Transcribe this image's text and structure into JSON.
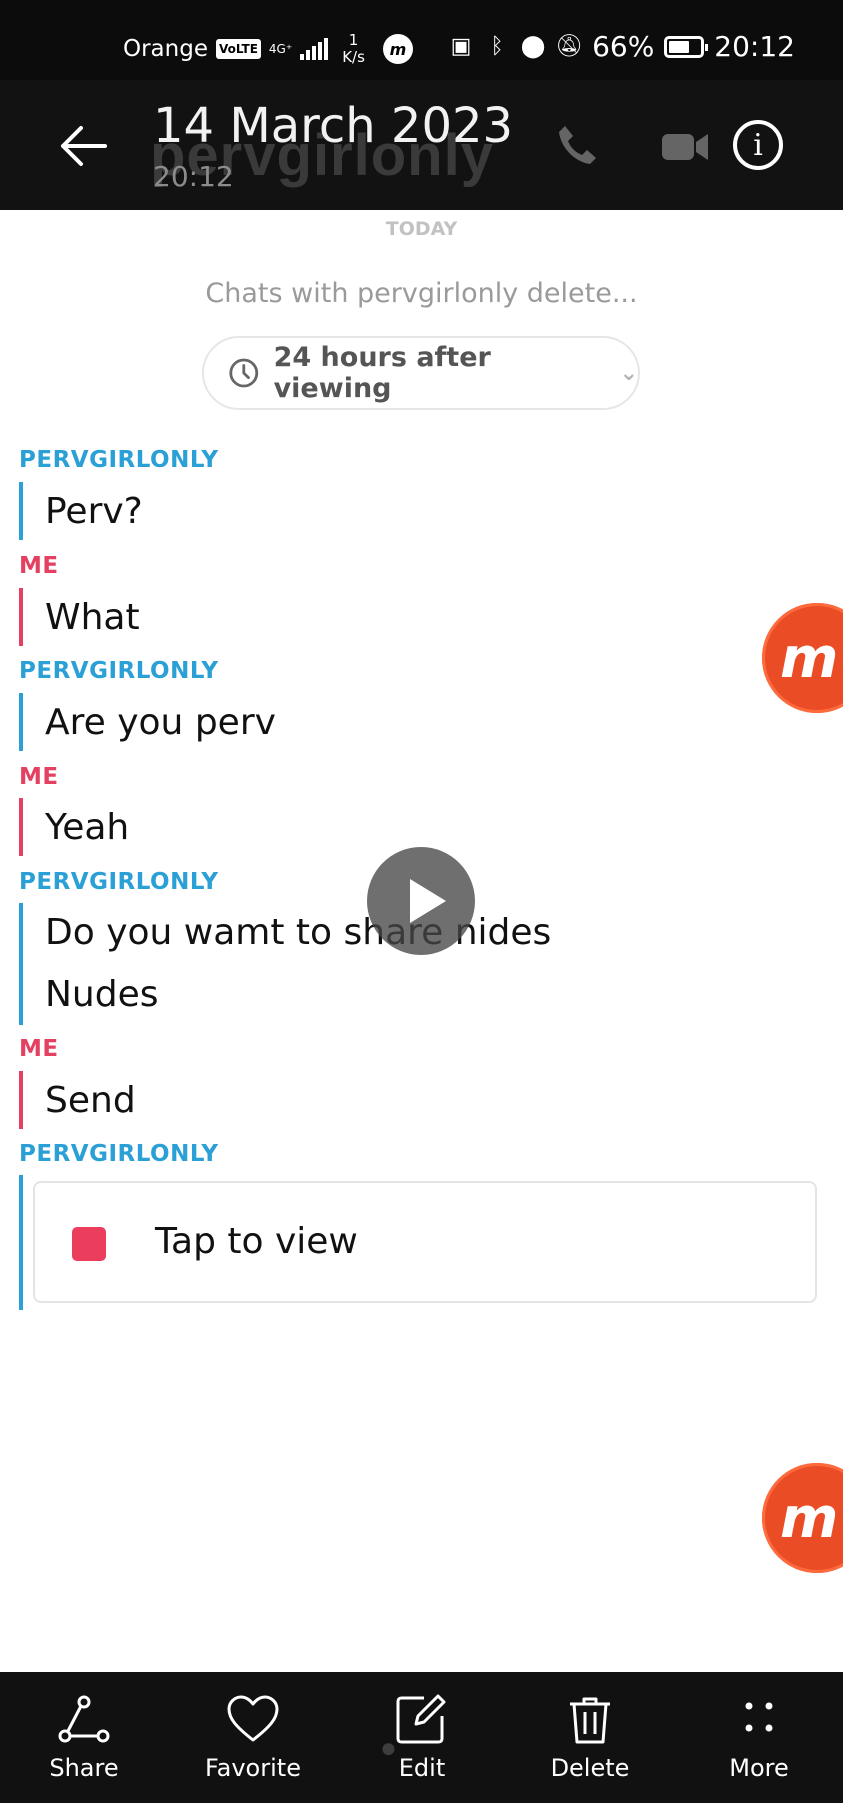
{
  "status_bar": {
    "carrier": "Orange",
    "volte": "VoLTE",
    "network": "4G⁺",
    "speed_value": "1",
    "speed_unit": "K/s",
    "battery": "66%",
    "battery_level": 0.66,
    "time": "20:12"
  },
  "header": {
    "title": "14 March 2023",
    "subtitle": "20:12",
    "ghost_name": "pervgirlonly"
  },
  "chat": {
    "day_label": "TODAY",
    "delete_note": "Chats with pervgirlonly delete...",
    "delete_setting": "24 hours after viewing",
    "messages": [
      {
        "sender": "PERVGIRLONLY",
        "lines": [
          "Perv?"
        ]
      },
      {
        "sender": "ME",
        "lines": [
          "What"
        ]
      },
      {
        "sender": "PERVGIRLONLY",
        "lines": [
          "Are you perv"
        ]
      },
      {
        "sender": "ME",
        "lines": [
          "Yeah"
        ]
      },
      {
        "sender": "PERVGIRLONLY",
        "lines": [
          "Do you wamt to share nides",
          "Nudes"
        ]
      },
      {
        "sender": "ME",
        "lines": [
          "Send"
        ]
      },
      {
        "sender": "PERVGIRLONLY",
        "lines": []
      }
    ],
    "snap_label": "Tap to view"
  },
  "bottom_bar": {
    "share": "Share",
    "favorite": "Favorite",
    "edit": "Edit",
    "delete": "Delete",
    "more": "More"
  },
  "colors": {
    "them": "#2aa0d6",
    "me": "#e34062",
    "snap": "#eb3d5c",
    "mobizen": "#ea4d25"
  }
}
